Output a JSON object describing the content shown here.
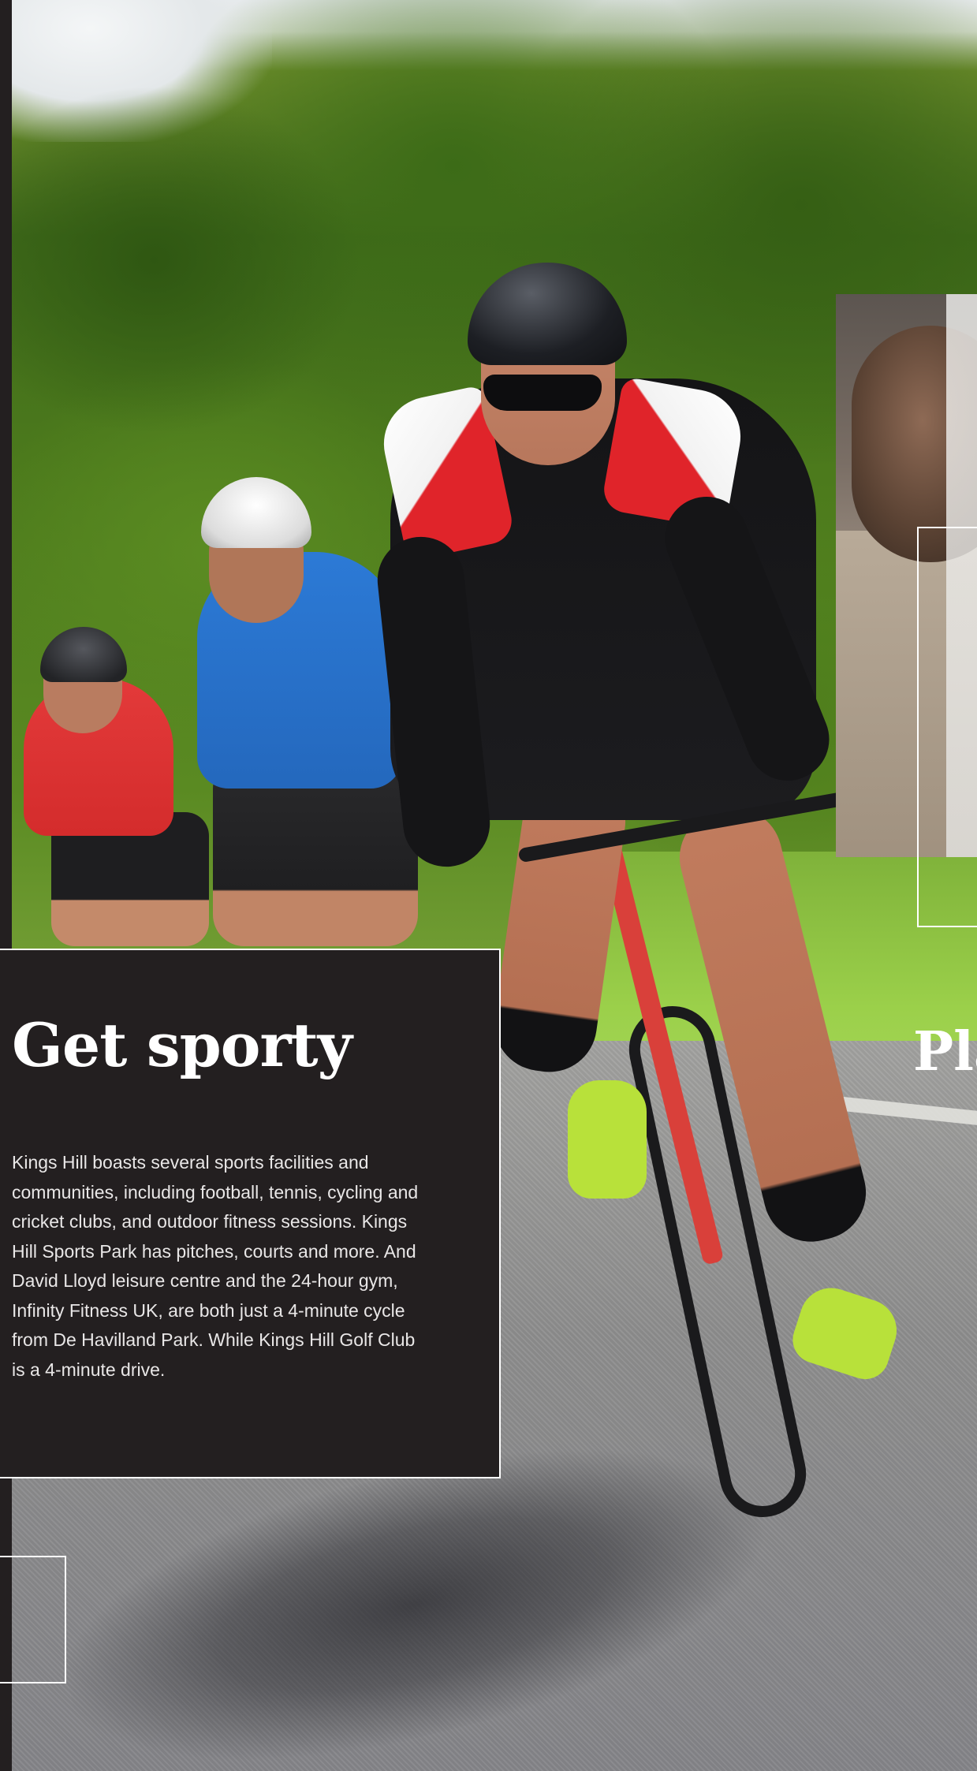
{
  "sections": {
    "sport": {
      "title": "Get sporty",
      "body": "Kings Hill boasts several sports facilities and communities, including football, tennis, cycling and cricket clubs, and outdoor fitness sessions. Kings Hill Sports Park has pitches, courts and more. And David Lloyd leisure centre and the 24-hour gym, Infinity Fitness UK, are both just a 4-minute cycle from De Havilland Park. While Kings Hill Golf Club is a 4-minute drive."
    },
    "next": {
      "title_partial": "Pla"
    }
  },
  "colors": {
    "background": "#231f20",
    "text": "#ffffff",
    "body_text": "#e9e7e7",
    "outline": "#ffffff"
  }
}
